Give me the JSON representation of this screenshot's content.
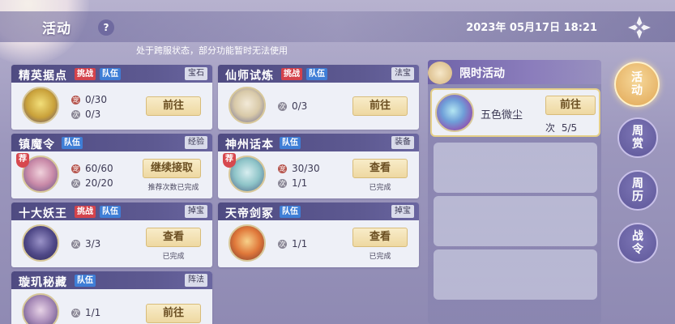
{
  "header": {
    "title": "活动",
    "help_label": "?",
    "datetime": "2023年 05月17日 18:21",
    "notice": "处于跨服状态，部分功能暂时无法使用"
  },
  "colors": {
    "tag_challenge": "#d4434c",
    "tag_team": "#3f7ed6",
    "button_gold": "#eed8a1",
    "panel_purple": "#5d5991"
  },
  "activities": [
    {
      "name": "精英据点",
      "tags": [
        "挑战",
        "队伍"
      ],
      "reward": "宝石",
      "stats": [
        {
          "icon": "宠",
          "value": "0/30"
        },
        {
          "icon": "次",
          "value": "0/3"
        }
      ],
      "button": "前往",
      "note": ""
    },
    {
      "name": "仙师试炼",
      "tags": [
        "挑战",
        "队伍"
      ],
      "reward": "法宝",
      "stats": [
        {
          "icon": "次",
          "value": "0/3"
        }
      ],
      "button": "前往",
      "note": ""
    },
    {
      "name": "镇魔令",
      "tags": [
        "队伍"
      ],
      "reward": "经验",
      "badge": "荐",
      "stats": [
        {
          "icon": "宠",
          "value": "60/60"
        },
        {
          "icon": "次",
          "value": "20/20"
        }
      ],
      "button": "继续接取",
      "note": "推荐次数已完成"
    },
    {
      "name": "神州话本",
      "tags": [
        "队伍"
      ],
      "reward": "装备",
      "badge": "荐",
      "stats": [
        {
          "icon": "宠",
          "value": "30/30"
        },
        {
          "icon": "次",
          "value": "1/1"
        }
      ],
      "button": "查看",
      "note": "已完成"
    },
    {
      "name": "十大妖王",
      "tags": [
        "挑战",
        "队伍"
      ],
      "reward": "掉宝",
      "stats": [
        {
          "icon": "次",
          "value": "3/3"
        }
      ],
      "button": "查看",
      "note": "已完成"
    },
    {
      "name": "天帝剑冢",
      "tags": [
        "队伍"
      ],
      "reward": "掉宝",
      "stats": [
        {
          "icon": "次",
          "value": "1/1"
        }
      ],
      "button": "查看",
      "note": "已完成"
    },
    {
      "name": "璇玑秘藏",
      "tags": [
        "队伍"
      ],
      "reward": "阵法",
      "stats": [
        {
          "icon": "次",
          "value": "1/1"
        }
      ],
      "button": "前往",
      "note": ""
    }
  ],
  "limited": {
    "title": "限时活动",
    "item_name": "五色微尘",
    "button": "前往",
    "count_label": "次",
    "count_value": "5/5"
  },
  "side_tabs": [
    {
      "label": "活动",
      "active": true
    },
    {
      "label": "周赏",
      "active": false
    },
    {
      "label": "周历",
      "active": false
    },
    {
      "label": "战令",
      "active": false
    }
  ]
}
